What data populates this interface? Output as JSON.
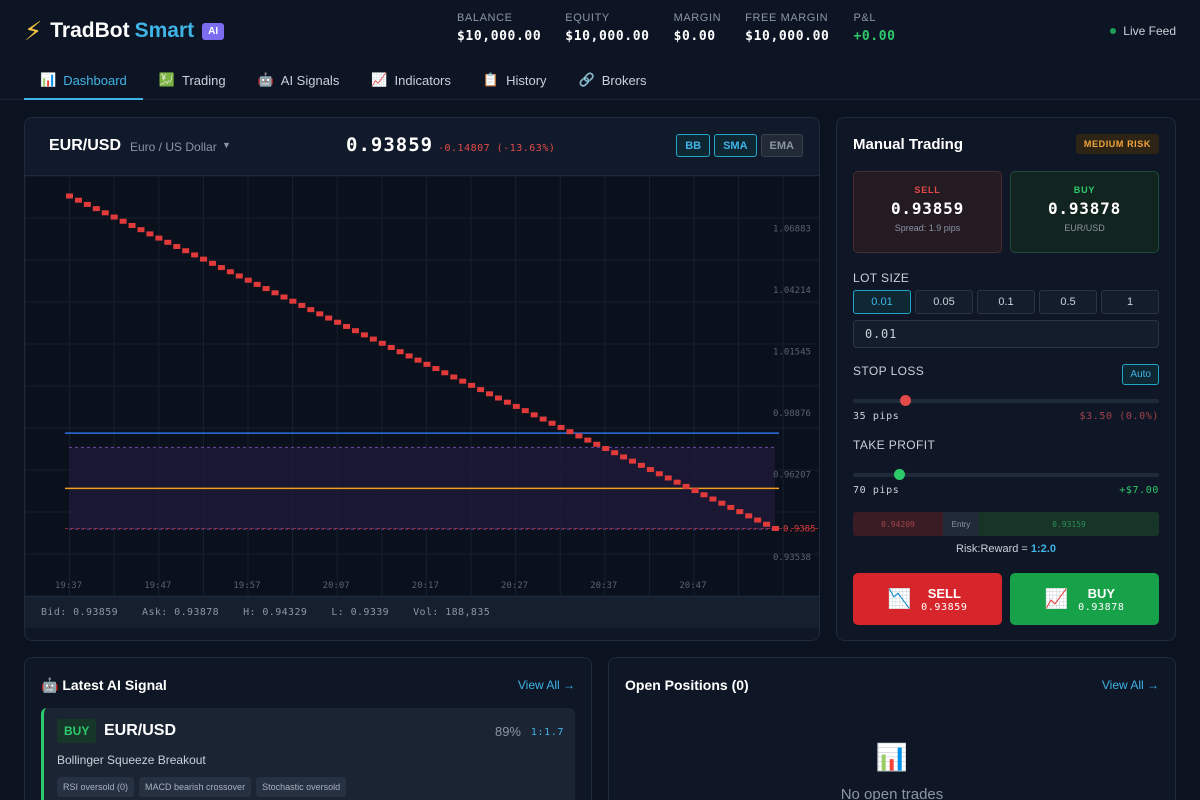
{
  "brand": {
    "name": "TradBot",
    "accent": "Smart",
    "badge": "AI"
  },
  "stats": [
    {
      "label": "BALANCE",
      "value": "$10,000.00",
      "tone": "neutral"
    },
    {
      "label": "EQUITY",
      "value": "$10,000.00",
      "tone": "neutral"
    },
    {
      "label": "MARGIN",
      "value": "$0.00",
      "tone": "neutral"
    },
    {
      "label": "FREE MARGIN",
      "value": "$10,000.00",
      "tone": "neutral"
    },
    {
      "label": "P&L",
      "value": "+0.00",
      "tone": "positive"
    }
  ],
  "live_feed": "Live Feed",
  "nav": [
    {
      "label": "Dashboard",
      "icon": "📊",
      "active": true
    },
    {
      "label": "Trading",
      "icon": "💹"
    },
    {
      "label": "AI Signals",
      "icon": "🤖"
    },
    {
      "label": "Indicators",
      "icon": "📈"
    },
    {
      "label": "History",
      "icon": "📋"
    },
    {
      "label": "Brokers",
      "icon": "🔗"
    }
  ],
  "chart": {
    "pair": "EUR/USD",
    "description": "Euro / US Dollar",
    "price": "0.93859",
    "change": "-0.14807 (-13.63%)",
    "indicators": [
      {
        "label": "BB",
        "active": true
      },
      {
        "label": "SMA",
        "active": true
      },
      {
        "label": "EMA",
        "active": false
      }
    ],
    "footer": {
      "bid": "Bid: 0.93859",
      "ask": "Ask: 0.93878",
      "high": "H: 0.94329",
      "low": "L: 0.9339",
      "vol": "Vol: 188,835"
    }
  },
  "chart_data": {
    "type": "line",
    "title": "",
    "xlabel": "",
    "ylabel": "",
    "x_ticks": [
      "19:37",
      "19:47",
      "19:57",
      "20:07",
      "20:17",
      "20:27",
      "20:37",
      "20:47"
    ],
    "y_ticks": [
      "1.06883",
      "1.04214",
      "1.01545",
      "0.98876",
      "0.96207",
      "0.93538"
    ],
    "ylim": [
      0.9223,
      1.0829
    ],
    "series": [
      {
        "values": [
          1.0829,
          0.93859
        ]
      }
    ],
    "overlays": [
      {
        "value": 0.98
      },
      {
        "value": 0.956
      }
    ],
    "band": {
      "upper": 0.9738,
      "lower": 0.9383
    },
    "last_price_label": "0.9385",
    "colors": {
      "candles": "#e03a3a",
      "sma": "#2f6fe0",
      "ema": "#f0a020",
      "band": "#6a4aa0"
    },
    "grid": true
  },
  "manual": {
    "title": "Manual Trading",
    "risk": "MEDIUM RISK",
    "sell_label": "SELL",
    "sell_price": "0.93859",
    "spread": "Spread: 1.9 pips",
    "buy_label": "BUY",
    "buy_price": "0.93878",
    "buy_sub": "EUR/USD",
    "lot_label": "LOT SIZE",
    "lots": [
      "0.01",
      "0.05",
      "0.1",
      "0.5",
      "1"
    ],
    "lot_value": "0.01",
    "sl_label": "STOP LOSS",
    "sl_auto": "Auto",
    "sl_pips": "35 pips",
    "sl_amount": "$3.50 (0.0%)",
    "sl_fraction": 0.17,
    "tp_label": "TAKE PROFIT",
    "tp_pips": "70 pips",
    "tp_amount": "+$7.00",
    "tp_fraction": 0.15,
    "rr_sl": "0.94209",
    "rr_entry": "Entry",
    "rr_tp": "0.93159",
    "rr_text": "Risk:Reward = ",
    "rr_value": "1:2.0",
    "sell_btn": "SELL",
    "sell_btn_price": "0.93859",
    "buy_btn": "BUY",
    "buy_btn_price": "0.93878"
  },
  "signal": {
    "title": "🤖 Latest AI Signal",
    "view_all": "View All →",
    "direction": "BUY",
    "pair": "EUR/USD",
    "confidence": "89%",
    "rr": "1:1.7",
    "name": "Bollinger Squeeze Breakout",
    "tags": [
      "RSI oversold (0)",
      "MACD bearish crossover",
      "Stochastic oversold"
    ]
  },
  "positions": {
    "title": "Open Positions (0)",
    "view_all": "View All →",
    "empty_icon": "📊",
    "empty_text": "No open trades"
  }
}
